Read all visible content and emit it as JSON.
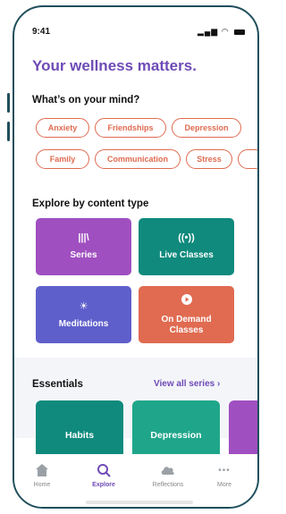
{
  "status": {
    "time": "9:41",
    "signal_glyph": "▂▄▆",
    "wifi_glyph": "◠"
  },
  "header": {
    "title": "Your wellness matters."
  },
  "topics": {
    "heading": "What’s on your mind?",
    "chips_row1": [
      "Anxiety",
      "Friendships",
      "Depression"
    ],
    "chips_row2": [
      "Family",
      "Communication",
      "Stress"
    ]
  },
  "content_types": {
    "heading": "Explore by content type",
    "tiles": [
      {
        "label": "Series",
        "icon": "library-icon",
        "color": "#a04fc0"
      },
      {
        "label": "Live Classes",
        "icon": "broadcast-icon",
        "color": "#0f8a7d"
      },
      {
        "label": "Meditations",
        "icon": "sun-icon",
        "color": "#5f5fcc"
      },
      {
        "label": "On Demand Classes",
        "icon": "play-icon",
        "color": "#e06b51"
      }
    ]
  },
  "essentials": {
    "heading": "Essentials",
    "view_all": "View all series ›",
    "cards": [
      {
        "label": "Habits",
        "color": "#0f8a7d"
      },
      {
        "label": "Depression",
        "color": "#1fa68a"
      }
    ]
  },
  "tabs": [
    {
      "label": "Home",
      "icon": "home-icon"
    },
    {
      "label": "Explore",
      "icon": "search-icon",
      "active": true
    },
    {
      "label": "Reflections",
      "icon": "cloud-icon"
    },
    {
      "label": "More",
      "icon": "more-icon"
    }
  ],
  "colors": {
    "accent": "#6e4bb6",
    "chip": "#e06b51",
    "frame": "#1f4f5c"
  }
}
